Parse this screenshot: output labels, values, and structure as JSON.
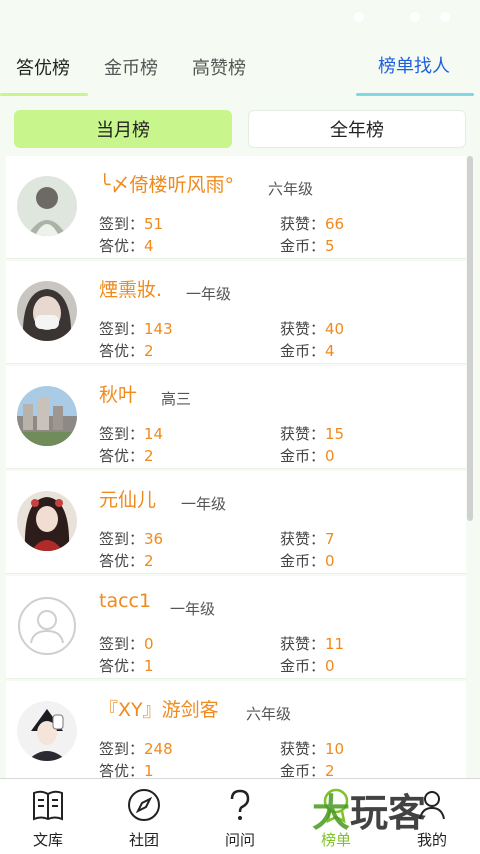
{
  "tabs": [
    "答优榜",
    "金币榜",
    "高赞榜"
  ],
  "find_people": "榜单找人",
  "period": {
    "month": "当月榜",
    "year": "全年榜"
  },
  "labels": {
    "checkin": "签到：",
    "likes": "获赞：",
    "best": "答优：",
    "coins": "金币："
  },
  "users": [
    {
      "name": "╰〆倚楼听风雨°",
      "grade": "六年级",
      "checkin": "51",
      "likes": "66",
      "best": "4",
      "coins": "5",
      "avatar": "photo-girl-drawing"
    },
    {
      "name": "煙熏妝.",
      "grade": "一年级",
      "checkin": "143",
      "likes": "40",
      "best": "2",
      "coins": "4",
      "avatar": "photo-girl-mask"
    },
    {
      "name": "秋叶",
      "grade": "高三",
      "checkin": "14",
      "likes": "15",
      "best": "2",
      "coins": "0",
      "avatar": "photo-city"
    },
    {
      "name": "元仙儿",
      "grade": "一年级",
      "checkin": "36",
      "likes": "7",
      "best": "2",
      "coins": "0",
      "avatar": "photo-anime-girl"
    },
    {
      "name": "tacc1",
      "grade": "一年级",
      "checkin": "0",
      "likes": "11",
      "best": "1",
      "coins": "0",
      "avatar": "default-user-icon"
    },
    {
      "name": "『XY』游剑客",
      "grade": "六年级",
      "checkin": "248",
      "likes": "10",
      "best": "1",
      "coins": "2",
      "avatar": "photo-anime-boy"
    }
  ],
  "nav": [
    {
      "label": "文库",
      "icon": "book-icon"
    },
    {
      "label": "社团",
      "icon": "compass-icon"
    },
    {
      "label": "问问",
      "icon": "question-icon"
    },
    {
      "label": "榜单",
      "icon": "ranking-icon"
    },
    {
      "label": "我的",
      "icon": "user-icon"
    }
  ],
  "watermark": {
    "part1": "大",
    "part2": "玩客"
  },
  "colors": {
    "accent": "#c8f58c",
    "orange": "#f08a1c",
    "nav_active": "#7ec22a",
    "find_people": "#2060e0"
  }
}
